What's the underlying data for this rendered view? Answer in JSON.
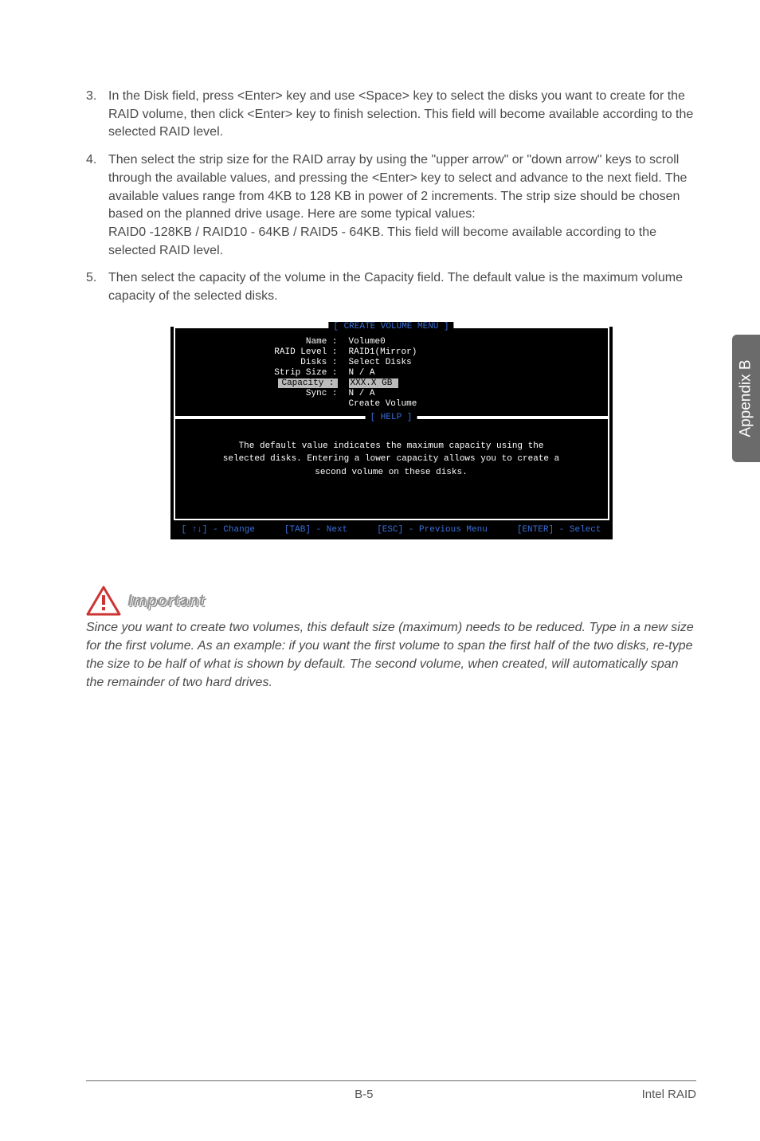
{
  "list": {
    "i3": {
      "num": "3.",
      "text": "In the Disk field, press <Enter> key and use <Space> key to select the disks you want to create for the RAID volume, then click <Enter> key to finish selection. This field will become available according to the selected RAID level."
    },
    "i4": {
      "num": "4.",
      "text": "Then select the strip size for the RAID array by using the \"upper arrow\" or \"down arrow\" keys to scroll through the available values, and pressing the <Enter> key to select and advance to the next field. The available values range from 4KB to 128 KB in power of 2 increments. The strip size should be chosen based on the planned drive usage. Here are some typical values:\nRAID0 -128KB / RAID10 - 64KB / RAID5 - 64KB. This field will become available according to the selected RAID level."
    },
    "i5": {
      "num": "5.",
      "text": "Then select the capacity of the volume in the Capacity field. The default value is the maximum volume capacity of the selected disks."
    }
  },
  "sideTab": "Appendix B",
  "bios": {
    "title1": "[  CREATE VOLUME MENU  ]",
    "fields": {
      "name_k": "Name :",
      "name_v": "Volume0",
      "raid_k": "RAID Level :",
      "raid_v": "RAID1(Mirror)",
      "disks_k": "Disks :",
      "disks_v": "Select  Disks",
      "strip_k": "Strip Size :",
      "strip_v": "N / A",
      "cap_k": "Capacity :",
      "cap_v": "XXX.X  GB",
      "sync_k": "Sync :",
      "sync_v": "N / A",
      "create_v": "Create Volume"
    },
    "title2": "[   HELP   ]",
    "help": "The default value indicates the maximum capacity using the selected disks. Entering a lower capacity allows you to create a second volume  on  these  disks.",
    "foot": {
      "a": "[ ↑↓] - Change",
      "b": "[TAB] - Next",
      "c": "[ESC] - Previous Menu",
      "d": "[ENTER] - Select"
    }
  },
  "important": {
    "label": "Important",
    "body": "Since you want to create two volumes, this default size (maximum) needs to be reduced. Type in a new size for the first volume. As an example: if you want the first volume to span the first half of the two disks, re-type the size to be half of what is shown by default. The second volume, when created, will automatically span the remainder of two hard drives."
  },
  "footer": {
    "page": "B-5",
    "section": "Intel RAID"
  }
}
